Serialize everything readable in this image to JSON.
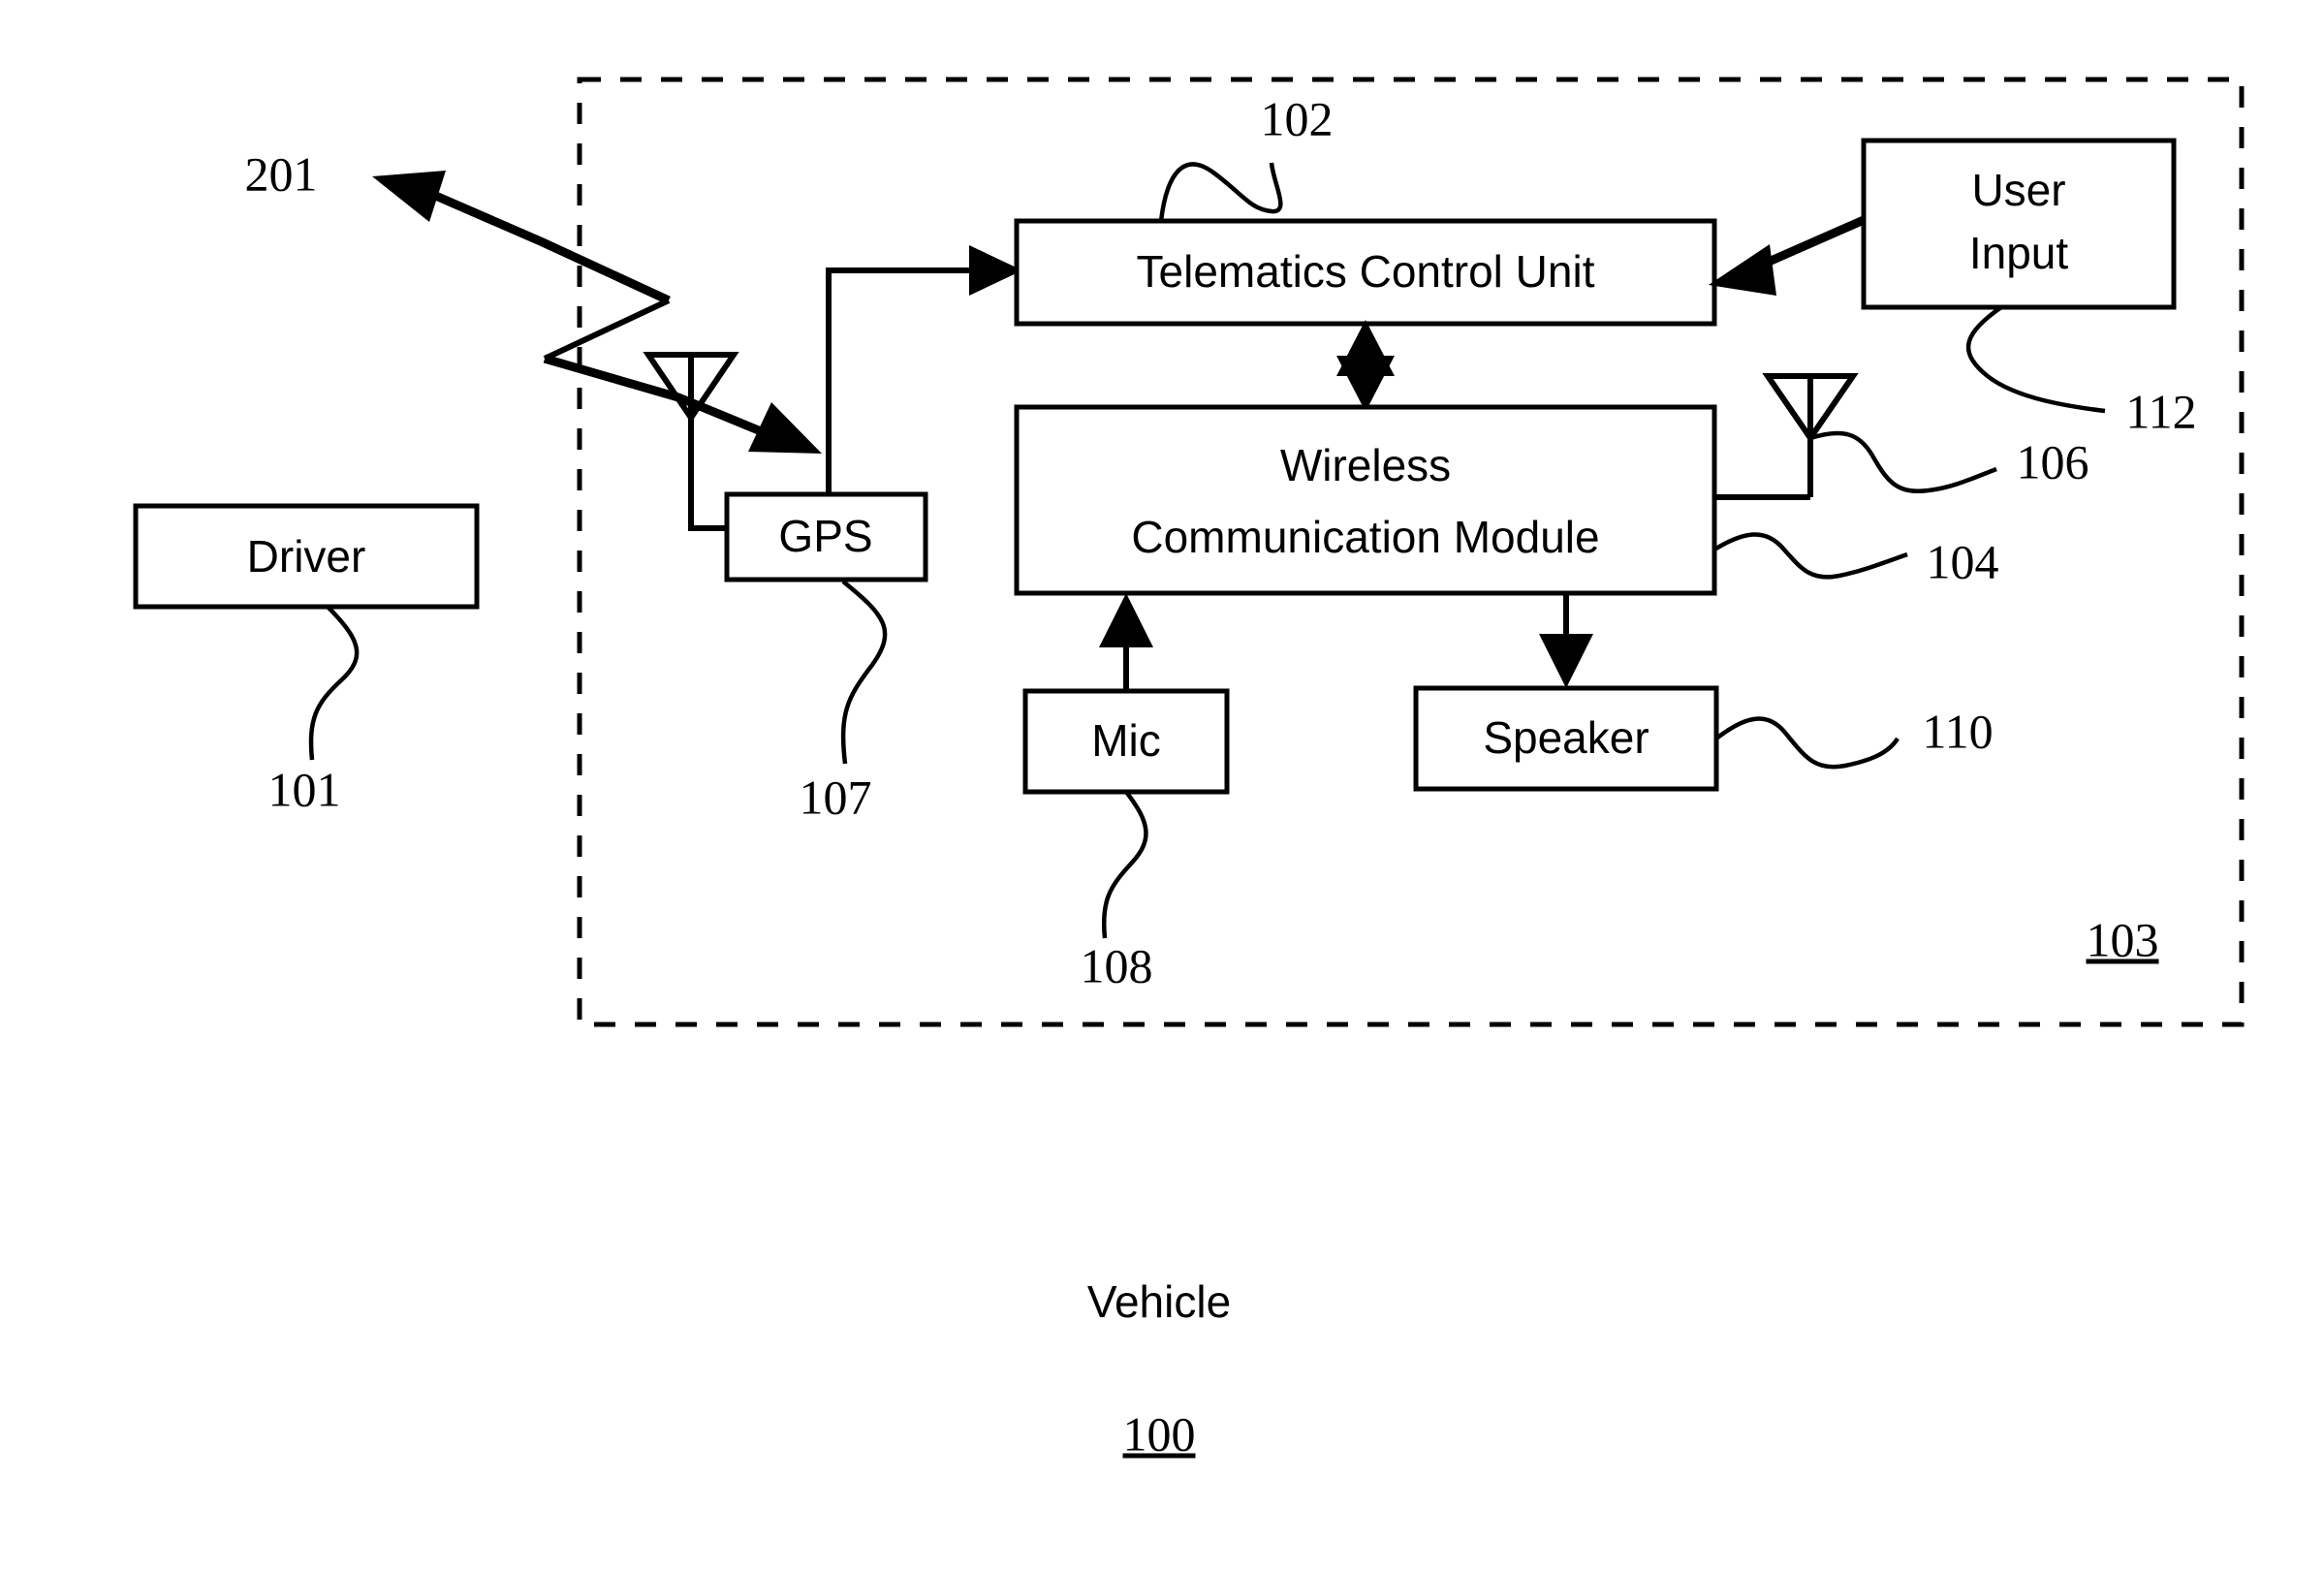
{
  "figure": {
    "title_caption": "Vehicle",
    "figure_number": "100",
    "boundary_ref": "103"
  },
  "boxes": {
    "driver": {
      "label": "Driver",
      "ref": "101"
    },
    "gps": {
      "label": "GPS",
      "ref": "107"
    },
    "telematics_control_unit": {
      "label": "Telematics Control Unit",
      "ref": "102"
    },
    "user_input": {
      "label_line1": "User",
      "label_line2": "Input",
      "ref": "112"
    },
    "wireless_communication_module": {
      "label_line1": "Wireless",
      "label_line2": "Communication Module",
      "ref": "104"
    },
    "mic": {
      "label": "Mic",
      "ref": "108"
    },
    "speaker": {
      "label": "Speaker",
      "ref": "110"
    }
  },
  "antennas": {
    "external_antenna_ref": "",
    "module_antenna_ref": "106"
  },
  "signals": {
    "wireless_link_ref": "201"
  },
  "colors": {
    "stroke": "#000000",
    "background": "#ffffff"
  }
}
